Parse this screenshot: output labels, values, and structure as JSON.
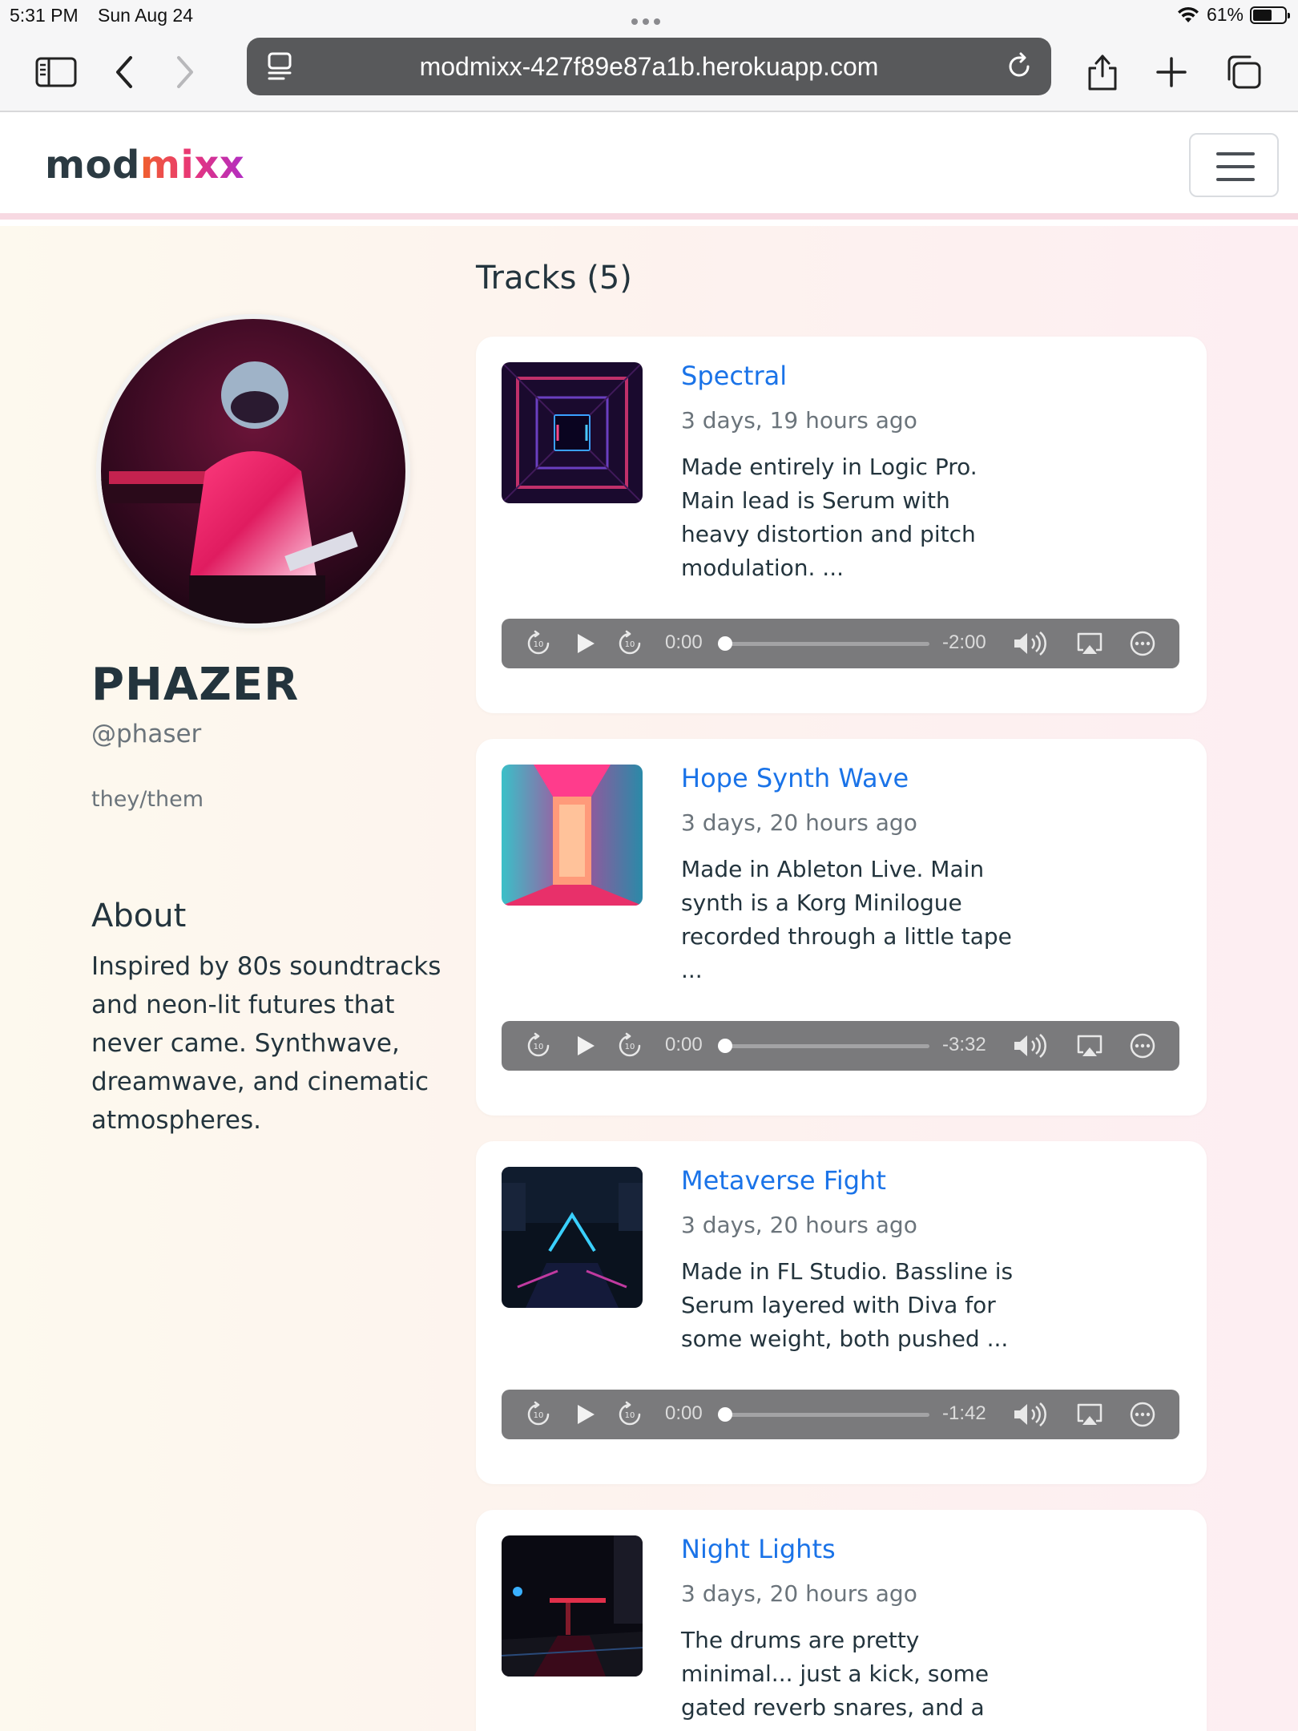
{
  "status_bar": {
    "time": "5:31 PM",
    "date": "Sun Aug 24",
    "battery": "61%",
    "battery_level": 0.61
  },
  "browser": {
    "url": "modmixx-427f89e87a1b.herokuapp.com",
    "icons": [
      "sidebar-icon",
      "back-icon",
      "forward-icon",
      "tab-info-icon",
      "reload-icon",
      "share-icon",
      "new-tab-icon",
      "tabs-icon"
    ]
  },
  "site": {
    "brand_main": "mod",
    "brand_accent": "mixx",
    "brand_color": "#2b3a42",
    "link_color": "#1a73e8"
  },
  "profile": {
    "name": "PHAZER",
    "handle": "@phaser",
    "pronouns": "they/them",
    "about_title": "About",
    "about_text": "Inspired by 80s soundtracks and neon-lit futures that never came. Synthwave, dreamwave, and cinematic atmospheres."
  },
  "tracks_header": "Tracks (5)",
  "tracks": [
    {
      "title": "Spectral",
      "time": "3 days, 19 hours ago",
      "description": "Made entirely in Logic Pro. Main lead is Serum with heavy distortion and pitch modulation. ...",
      "elapsed": "0:00",
      "remaining": "-2:00",
      "progress": 0
    },
    {
      "title": "Hope Synth Wave",
      "time": "3 days, 20 hours ago",
      "description": "Made in Ableton Live. Main synth is a Korg Minilogue recorded through a little tape ...",
      "elapsed": "0:00",
      "remaining": "-3:32",
      "progress": 0
    },
    {
      "title": "Metaverse Fight",
      "time": "3 days, 20 hours ago",
      "description": "Made in FL Studio. Bassline is Serum layered with Diva for some weight, both pushed ...",
      "elapsed": "0:00",
      "remaining": "-1:42",
      "progress": 0
    },
    {
      "title": "Night Lights",
      "time": "3 days, 20 hours ago",
      "description": "The drums are pretty minimal... just a kick, some gated reverb snares, and a"
    }
  ]
}
